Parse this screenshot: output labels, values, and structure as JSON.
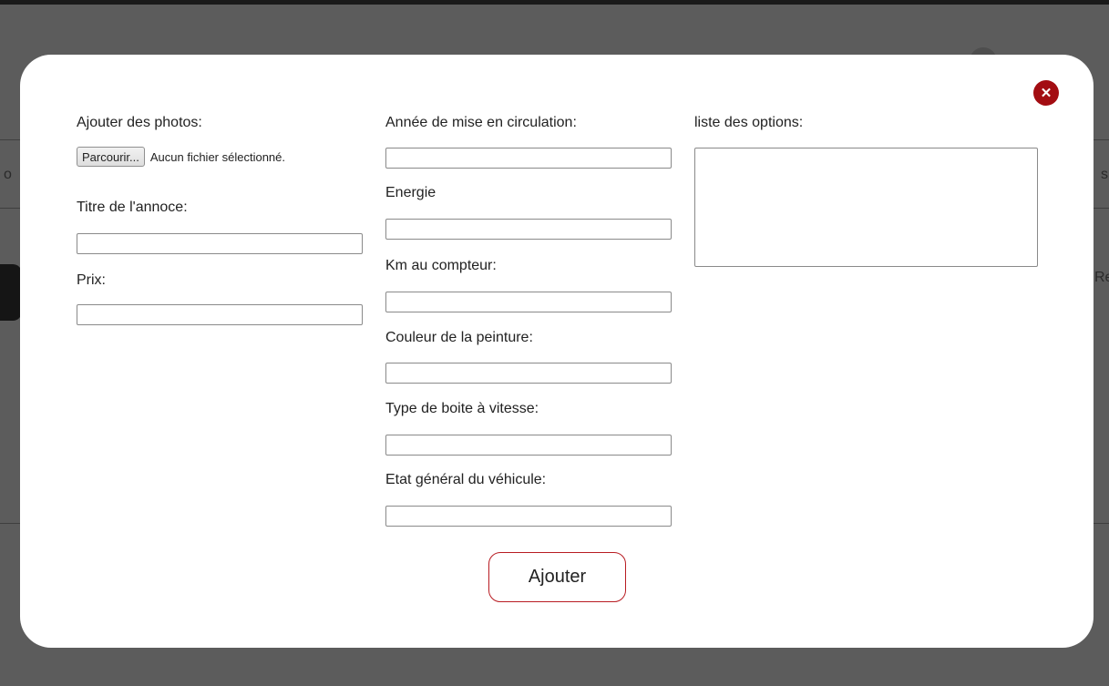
{
  "background": {
    "fragments": [
      "o",
      "s",
      "Re"
    ]
  },
  "modal": {
    "close_icon": "close-icon",
    "accent_color": "#a30d12",
    "photos": {
      "label": "Ajouter des photos:",
      "browse_button": "Parcourir...",
      "status": "Aucun fichier sélectionné."
    },
    "title_field": {
      "label": "Titre de l'annoce:",
      "value": ""
    },
    "price_field": {
      "label": "Prix:",
      "value": ""
    },
    "year_field": {
      "label": "Année de mise en circulation:",
      "value": ""
    },
    "energy_field": {
      "label": "Energie",
      "value": ""
    },
    "km_field": {
      "label": "Km au compteur:",
      "value": ""
    },
    "color_field": {
      "label": "Couleur de la peinture:",
      "value": ""
    },
    "gearbox_field": {
      "label": "Type de boite à vitesse:",
      "value": ""
    },
    "condition_field": {
      "label": "Etat général du véhicule:",
      "value": ""
    },
    "options_field": {
      "label": "liste des options:",
      "value": ""
    },
    "submit_label": "Ajouter"
  }
}
